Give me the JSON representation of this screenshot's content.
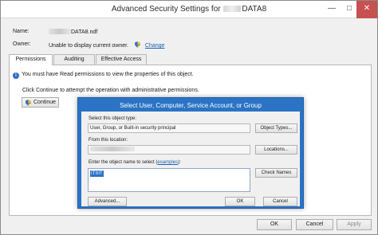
{
  "window": {
    "title_prefix": "Advanced Security Settings for",
    "title_suffix": "DATA8",
    "min_glyph": "—",
    "max_glyph": "□",
    "close_glyph": "✕"
  },
  "name_field": {
    "label": "Name:",
    "value_suffix": "DATA8.ndf"
  },
  "owner_field": {
    "label": "Owner:",
    "value": "Unable to display current owner.",
    "change_link": "Change"
  },
  "tabs": [
    {
      "label": "Permissions",
      "active": true
    },
    {
      "label": "Auditing",
      "active": false
    },
    {
      "label": "Effective Access",
      "active": false
    }
  ],
  "info_message": "You must have Read permissions to view the properties of this object.",
  "continue_message": "Click Continue to attempt the operation with administrative permissions.",
  "continue_button": "Continue",
  "bottom_buttons": {
    "ok": "OK",
    "cancel": "Cancel",
    "apply": "Apply"
  },
  "dialog": {
    "title": "Select User, Computer, Service Account, or Group",
    "object_type_label": "Select this object type:",
    "object_type_value": "User, Group, or Built-in security principal",
    "object_types_button": "Object Types...",
    "location_label": "From this location:",
    "locations_button": "Locations...",
    "object_name_label_prefix": "Enter the object name to select (",
    "examples_link": "examples",
    "object_name_label_suffix": "):",
    "check_names_button": "Check Names",
    "entered_name": "ITSIT",
    "advanced_button": "Advanced...",
    "ok_button": "OK",
    "cancel_button": "Cancel"
  },
  "colors": {
    "dialog_titlebar": "#2a73c5",
    "close_button": "#c75050",
    "link": "#1a5fb4"
  },
  "icons": [
    "info-icon",
    "uac-shield-icon"
  ]
}
